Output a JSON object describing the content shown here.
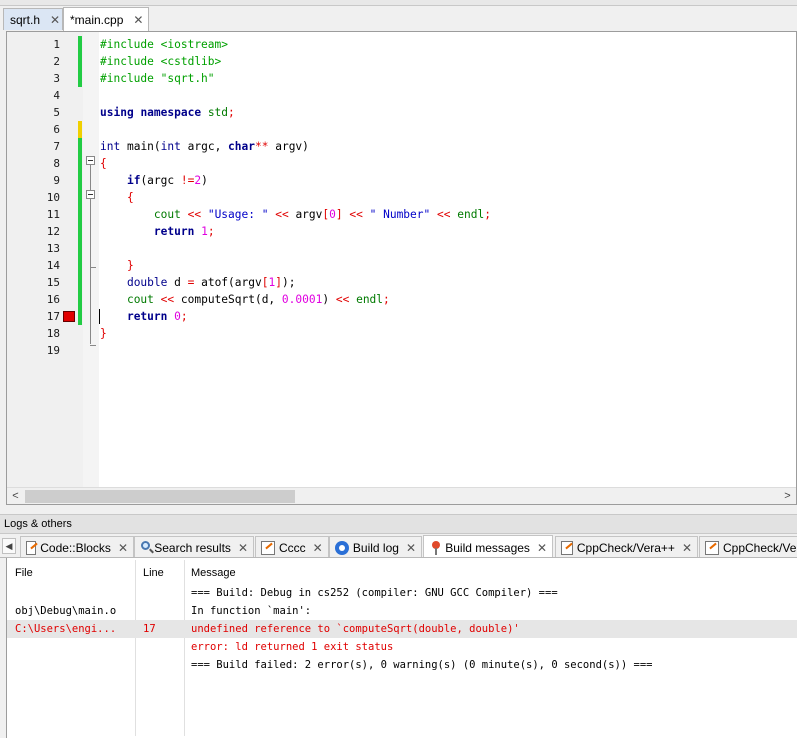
{
  "editor_tabs": [
    {
      "label": "sqrt.h",
      "close": "✕",
      "active": false
    },
    {
      "label": "*main.cpp",
      "close": "✕",
      "active": true
    }
  ],
  "line_numbers": [
    "1",
    "2",
    "3",
    "4",
    "5",
    "6",
    "7",
    "8",
    "9",
    "10",
    "11",
    "12",
    "13",
    "14",
    "15",
    "16",
    "17",
    "18",
    "19"
  ],
  "code": {
    "l1_dir": "#include",
    "l1_arg": "<iostream>",
    "l2_dir": "#include",
    "l2_arg": "<cstdlib>",
    "l3_dir": "#include",
    "l3_arg": "\"sqrt.h\"",
    "l5_using": "using",
    "l5_ns": "namespace",
    "l5_std": "std",
    "l7_int": "int",
    "l7_main": "main(",
    "l7_int2": "int",
    "l7_argc": "argc, ",
    "l7_char": "char",
    "l7_ptr": "**",
    "l7_argv": " argv)",
    "l8": "{",
    "l9_if": "if",
    "l9_a": "(argc ",
    "l9_op": "!=",
    "l9_num": "2",
    "l9_b": ")",
    "l10": "{",
    "l11_cout": "cout",
    "l11_op1": "<<",
    "l11_str1": "\"Usage: \"",
    "l11_op2": "<<",
    "l11_argv": "argv",
    "l11_br1": "[",
    "l11_idx": "0",
    "l11_br2": "]",
    "l11_op3": "<<",
    "l11_str2": "\" Number\"",
    "l11_op4": "<<",
    "l11_endl": "endl",
    "l12_ret": "return",
    "l12_num": "1",
    "l14": "}",
    "l15_double": "double",
    "l15_d": "d ",
    "l15_eq": "=",
    "l15_atof": " atof(argv",
    "l15_br1": "[",
    "l15_idx": "1",
    "l15_br2": "]",
    "l15_end": ");",
    "l16_cout": "cout",
    "l16_op1": "<<",
    "l16_call": " computeSqrt(d, ",
    "l16_num": "0.0001",
    "l16_close": ")",
    "l16_op2": "<<",
    "l16_endl": "endl",
    "l17_ret": "return",
    "l17_num": "0",
    "l18": "}"
  },
  "logs_panel_title": "Logs & others",
  "log_tabs": [
    {
      "label": "Code::Blocks",
      "icon": "document-icon",
      "close": "✕"
    },
    {
      "label": "Search results",
      "icon": "search-icon",
      "close": "✕"
    },
    {
      "label": "Cccc",
      "icon": "document-icon",
      "close": "✕"
    },
    {
      "label": "Build log",
      "icon": "gear-icon",
      "close": "✕"
    },
    {
      "label": "Build messages",
      "icon": "pin-icon",
      "close": "✕"
    },
    {
      "label": "CppCheck/Vera++",
      "icon": "document-icon",
      "close": "✕"
    },
    {
      "label": "CppCheck/Ve",
      "icon": "document-icon",
      "close": ""
    }
  ],
  "log_columns": {
    "file": "File",
    "line": "Line",
    "message": "Message"
  },
  "log_rows": [
    {
      "file": "",
      "line": "",
      "message": "=== Build: Debug in cs252 (compiler: GNU GCC Compiler) ===",
      "error": false
    },
    {
      "file": "obj\\Debug\\main.o",
      "line": "",
      "message": "In function `main':",
      "error": false
    },
    {
      "file": "C:\\Users\\engi...",
      "line": "17",
      "message": "undefined reference to `computeSqrt(double, double)'",
      "error": true
    },
    {
      "file": "",
      "line": "",
      "message": "error: ld returned 1 exit status",
      "error": true
    },
    {
      "file": "",
      "line": "",
      "message": "=== Build failed: 2 error(s), 0 warning(s) (0 minute(s), 0 second(s)) ===",
      "error": false
    }
  ],
  "colors": {
    "changed_line": "#22cc44",
    "unsaved_line": "#f0d000",
    "breakpoint": "#e00000",
    "error_text": "#e00000"
  }
}
